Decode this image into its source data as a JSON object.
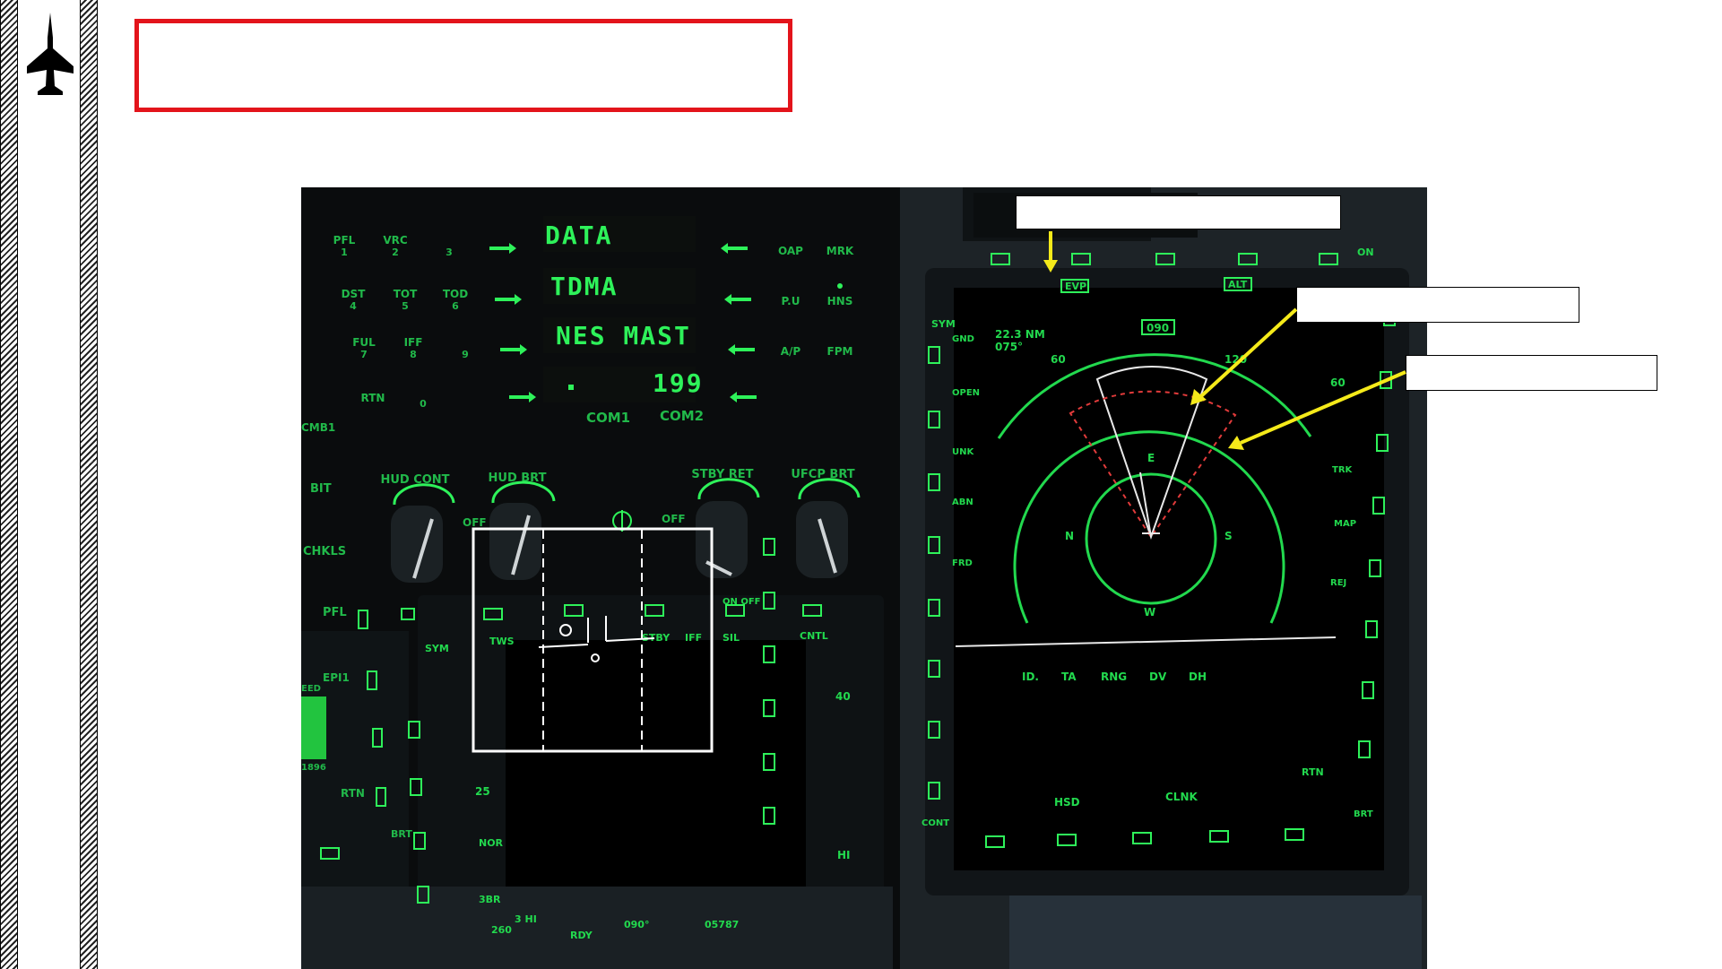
{
  "ufc": {
    "keypad": [
      {
        "label": "PFL",
        "num": "1"
      },
      {
        "label": "VRC",
        "num": "2"
      },
      {
        "label": "",
        "num": "3"
      },
      {
        "label": "DST",
        "num": "4"
      },
      {
        "label": "TOT",
        "num": "5"
      },
      {
        "label": "TOD",
        "num": "6"
      },
      {
        "label": "FUL",
        "num": "7"
      },
      {
        "label": "IFF",
        "num": "8"
      },
      {
        "label": "",
        "num": "9"
      },
      {
        "label": "RTN",
        "num": ""
      },
      {
        "label": "",
        "num": "0"
      }
    ],
    "display_lines": [
      "DATA",
      "TDMA",
      "NES MAST",
      "199"
    ],
    "com_labels": [
      "COM1",
      "COM2"
    ],
    "right_buttons": [
      "OAP",
      "MRK",
      "P.U",
      "HNS",
      "A/P",
      "FPM"
    ],
    "knobs": [
      "HUD CONT",
      "HUD BRT",
      "STBY RET",
      "UFCP BRT"
    ],
    "off_labels": [
      "OFF",
      "OFF"
    ]
  },
  "left_panel": {
    "labels": [
      "BIT",
      "CHKLS",
      "PFL",
      "EPI1",
      "RTN",
      "BRT"
    ],
    "edge_labels": [
      "CMB1",
      "EED",
      "1896"
    ]
  },
  "hsd_mfd": {
    "top_labels": [
      "EVP",
      "090",
      "ALT"
    ],
    "left_labels": [
      "SYM",
      "GND",
      "OPEN",
      "UNK",
      "ABN",
      "FRD"
    ],
    "right_labels": [
      "60",
      "TRK",
      "MAP",
      "REJ",
      "RTN",
      "BRT",
      "ON"
    ],
    "range_text": "22.3 NM",
    "bearing_text": "075°",
    "scale_marks": [
      "60",
      "120"
    ],
    "compass": [
      "N",
      "E",
      "S",
      "W"
    ],
    "table_headers": [
      "ID.",
      "TA",
      "RNG",
      "DV",
      "DH"
    ],
    "bottom_labels": [
      "HSD",
      "CLNK",
      "CONT"
    ]
  },
  "radar_mfd": {
    "top_labels": [
      "TWS",
      "STBY",
      "IFF",
      "SIL",
      "CNTL"
    ],
    "left_labels": [
      "SYM",
      "25",
      "NOR",
      "3BR"
    ],
    "right_labels": [
      "40",
      "HI",
      "ON OFF"
    ],
    "bottom_labels": [
      "260",
      "3 HI",
      "RDY",
      "090°",
      "05787"
    ]
  },
  "colors": {
    "accent_green": "#2ef25a",
    "callout_yellow": "#f5ea1a",
    "title_border": "#e3141b"
  }
}
